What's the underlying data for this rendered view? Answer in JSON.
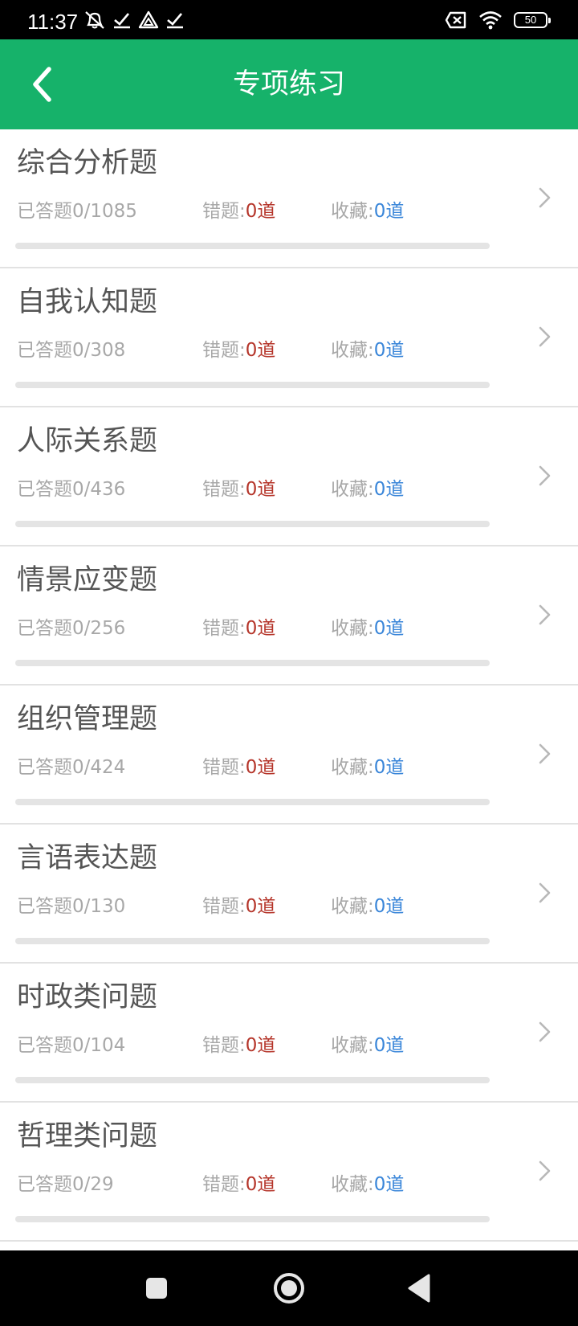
{
  "status_bar": {
    "time": "11:37",
    "battery": "50"
  },
  "header": {
    "title": "专项练习"
  },
  "labels": {
    "answered_prefix": "已答题",
    "wrong_prefix": "错题:",
    "fav_prefix": "收藏:",
    "unit": "道"
  },
  "items": [
    {
      "title": "综合分析题",
      "answered": "0/1085",
      "wrong": "0",
      "fav": "0",
      "progress": 0
    },
    {
      "title": "自我认知题",
      "answered": "0/308",
      "wrong": "0",
      "fav": "0",
      "progress": 0
    },
    {
      "title": "人际关系题",
      "answered": "0/436",
      "wrong": "0",
      "fav": "0",
      "progress": 0
    },
    {
      "title": "情景应变题",
      "answered": "0/256",
      "wrong": "0",
      "fav": "0",
      "progress": 0
    },
    {
      "title": "组织管理题",
      "answered": "0/424",
      "wrong": "0",
      "fav": "0",
      "progress": 0
    },
    {
      "title": "言语表达题",
      "answered": "0/130",
      "wrong": "0",
      "fav": "0",
      "progress": 0
    },
    {
      "title": "时政类问题",
      "answered": "0/104",
      "wrong": "0",
      "fav": "0",
      "progress": 0
    },
    {
      "title": "哲理类问题",
      "answered": "0/29",
      "wrong": "0",
      "fav": "0",
      "progress": 0
    }
  ],
  "colors": {
    "accent": "#16b26a",
    "wrong": "#b5352a",
    "favorite": "#3a86d9"
  },
  "icons": {
    "back": "chevron-left-icon",
    "row": "chevron-right-icon",
    "nav_recents": "square-icon",
    "nav_home": "circle-home-icon",
    "nav_back": "triangle-back-icon"
  }
}
